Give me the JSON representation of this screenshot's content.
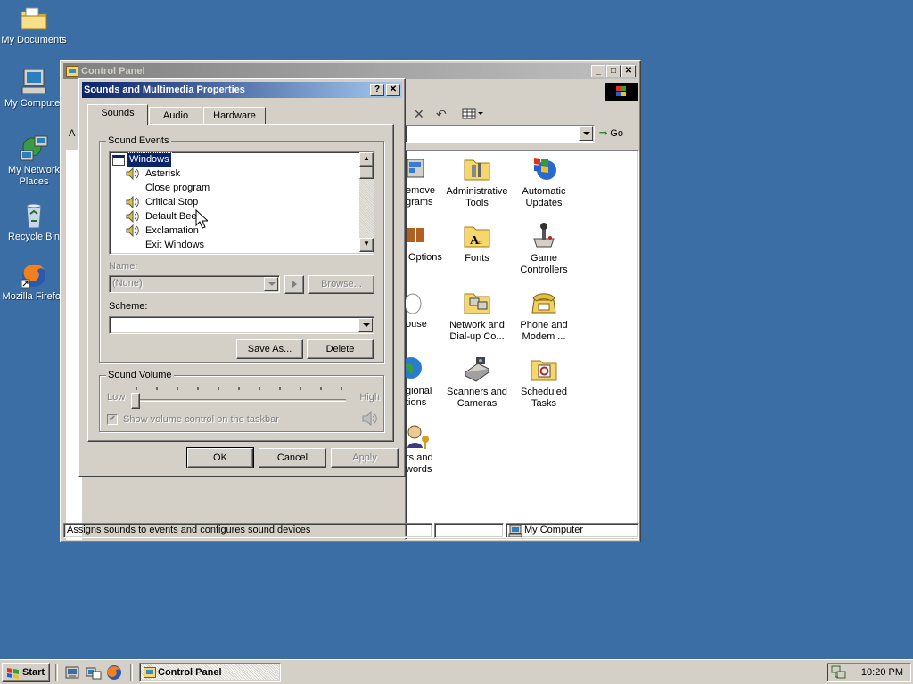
{
  "desktop": {
    "icons": [
      {
        "label": "My Documents"
      },
      {
        "label": "My Computer"
      },
      {
        "label_line1": "My Network",
        "label_line2": "Places"
      },
      {
        "label": "Recycle Bin"
      },
      {
        "label": "Mozilla Firefox"
      }
    ]
  },
  "control_panel": {
    "title": "Control Panel",
    "address_partial": "A",
    "go_label": "Go",
    "items": [
      {
        "line1": "Administrative",
        "line2": "Tools"
      },
      {
        "line1": "Automatic",
        "line2": "Updates"
      },
      {
        "line1": "Fonts",
        "line2": ""
      },
      {
        "line1": "Game",
        "line2": "Controllers"
      },
      {
        "line1": "Network and",
        "line2": "Dial-up Co..."
      },
      {
        "line1": "Phone and",
        "line2": "Modem ..."
      },
      {
        "line1": "Scanners and",
        "line2": "Cameras"
      },
      {
        "line1": "Scheduled",
        "line2": "Tasks"
      }
    ],
    "partial_items": [
      {
        "line1": "emove",
        "line2": "grams"
      },
      {
        "line1": "Options",
        "line2": ""
      },
      {
        "line1": "ouse",
        "line2": ""
      },
      {
        "line1": "gional",
        "line2": "tions"
      },
      {
        "line1": "rs and",
        "line2": "words"
      }
    ],
    "status_text": "Assigns sounds to events and configures sound devices",
    "status_zone": "My Computer"
  },
  "dialog": {
    "title": "Sounds and Multimedia Properties",
    "help_glyph": "?",
    "close_glyph": "✕",
    "tabs": [
      {
        "label": "Sounds"
      },
      {
        "label": "Audio"
      },
      {
        "label": "Hardware"
      }
    ],
    "sound_events": {
      "group_label": "Sound Events",
      "items": [
        {
          "label": "Windows"
        },
        {
          "label": "Asterisk"
        },
        {
          "label": "Close program"
        },
        {
          "label": "Critical Stop"
        },
        {
          "label": "Default Beep"
        },
        {
          "label": "Exclamation"
        },
        {
          "label": "Exit Windows"
        }
      ]
    },
    "name_label": "Name:",
    "name_value": "(None)",
    "browse_label": "Browse...",
    "scheme_label": "Scheme:",
    "scheme_value": "",
    "save_as_label": "Save As...",
    "delete_label": "Delete",
    "volume": {
      "group_label": "Sound Volume",
      "low_label": "Low",
      "high_label": "High",
      "level": 0,
      "show_on_taskbar_label": "Show volume control on the taskbar",
      "show_on_taskbar_checked": true
    },
    "ok_label": "OK",
    "cancel_label": "Cancel",
    "apply_label": "Apply"
  },
  "taskbar": {
    "start_label": "Start",
    "task_label": "Control Panel",
    "clock": "10:20 PM"
  }
}
